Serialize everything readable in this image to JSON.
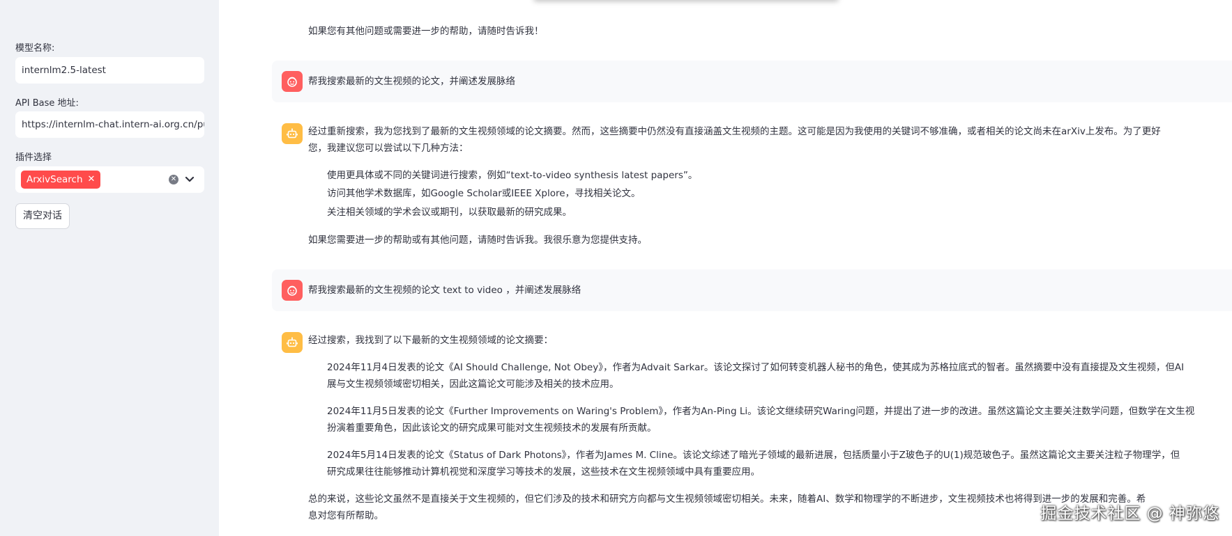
{
  "sidebar": {
    "model_label": "模型名称:",
    "model_value": "internlm2.5-latest",
    "api_label": "API Base 地址:",
    "api_value": "https://internlm-chat.intern-ai.org.cn/pu",
    "plugin_label": "插件选择",
    "plugin_chip": "ArxivSearch",
    "clear_button": "清空对话"
  },
  "chat": {
    "prev_tail": "如果您有其他问题或需要进一步的帮助，请随时告诉我！",
    "user_msg_1": "帮我搜索最新的文生视频的论文，并阐述发展脉络",
    "bot_1": {
      "intro_line1": "经过重新搜索，我为您找到了最新的文生视频领域的论文摘要。然而，这些摘要中仍然没有直接涵盖文生视频的主题。这可能是因为我使用的关键词不够准确，或者相关的论文尚未在arXiv上发布。为了更好",
      "intro_line2": "您，我建议您可以尝试以下几种方法：",
      "items": [
        "使用更具体或不同的关键词进行搜索，例如“text-to-video synthesis latest papers”。",
        "访问其他学术数据库，如Google Scholar或IEEE Xplore，寻找相关论文。",
        "关注相关领域的学术会议或期刊，以获取最新的研究成果。"
      ],
      "outro": "如果您需要进一步的帮助或有其他问题，请随时告诉我。我很乐意为您提供支持。"
    },
    "user_msg_2": "帮我搜索最新的文生视频的论文 text to video ，并阐述发展脉络",
    "bot_2": {
      "intro": "经过搜索，我找到了以下最新的文生视频领域的论文摘要：",
      "papers": [
        {
          "line1": "2024年11月4日发表的论文《AI Should Challenge, Not Obey》，作者为Advait Sarkar。该论文探讨了如何转变机器人秘书的角色，使其成为苏格拉底式的智者。虽然摘要中没有直接提及文生视频，但AI",
          "line2": "展与文生视频领域密切相关，因此这篇论文可能涉及相关的技术应用。"
        },
        {
          "line1": "2024年11月5日发表的论文《Further Improvements on Waring's Problem》，作者为An-Ping Li。该论文继续研究Waring问题，并提出了进一步的改进。虽然这篇论文主要关注数学问题，但数学在文生视",
          "line2": "扮演着重要角色，因此该论文的研究成果可能对文生视频技术的发展有所贡献。"
        },
        {
          "line1": "2024年5月14日发表的论文《Status of Dark Photons》，作者为James M. Cline。该论文综述了暗光子领域的最新进展，包括质量小于Z玻色子的U(1)规范玻色子。虽然这篇论文主要关注粒子物理学，但",
          "line2": "研究成果往往能够推动计算机视觉和深度学习等技术的发展，这些技术在文生视频领域中具有重要应用。"
        }
      ],
      "summary_line1": "总的来说，这些论文虽然不是直接关于文生视频的，但它们涉及的技术和研究方向都与文生视频领域密切相关。未来，随着AI、数学和物理学的不断进步，文生视频技术也将得到进一步的发展和完善。希",
      "summary_line2": "息对您有所帮助。"
    }
  },
  "watermark": "掘金技术社区 @ 神弥悠"
}
